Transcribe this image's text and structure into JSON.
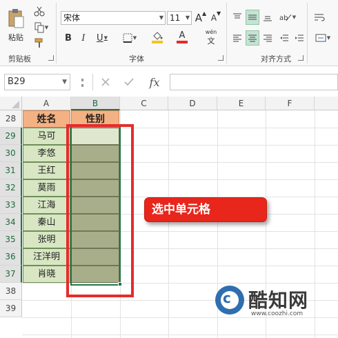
{
  "ribbon": {
    "clipboard": {
      "paste_label": "粘贴",
      "group_label": "剪贴板"
    },
    "font": {
      "name_value": "宋体",
      "size_value": "11",
      "bold_label": "B",
      "italic_label": "I",
      "underline_label": "U",
      "grow_label": "A",
      "shrink_label": "A",
      "phonetic_label": "wén",
      "font_color_label": "A",
      "font_color": "#e52b2b",
      "fill_color": "#f5c518",
      "group_label": "字体"
    },
    "alignment": {
      "group_label": "对齐方式"
    }
  },
  "formula_bar": {
    "name_box": "B29",
    "fx_label": "fx",
    "formula_value": ""
  },
  "grid": {
    "columns": [
      "A",
      "B",
      "C",
      "D",
      "E",
      "F"
    ],
    "selected_column": "B",
    "rows": [
      "28",
      "29",
      "30",
      "31",
      "32",
      "33",
      "34",
      "35",
      "36",
      "37",
      "38",
      "39"
    ],
    "header_row": {
      "a": "姓名",
      "b": "性别"
    },
    "names": [
      "马可",
      "李悠",
      "王红",
      "莫雨",
      "江海",
      "秦山",
      "张明",
      "汪洋明",
      "肖晓"
    ],
    "header_color": "#f4b183",
    "name_fill_color": "#d8e6c4",
    "selected_fill_color": "#a7ae89"
  },
  "callout": {
    "text": "选中单元格",
    "color": "#e8261c"
  },
  "annotation_rect_color": "#e52b2b",
  "watermark": {
    "title": "酷知网",
    "url": "www.coozhi.com",
    "logo_letter": "c"
  }
}
